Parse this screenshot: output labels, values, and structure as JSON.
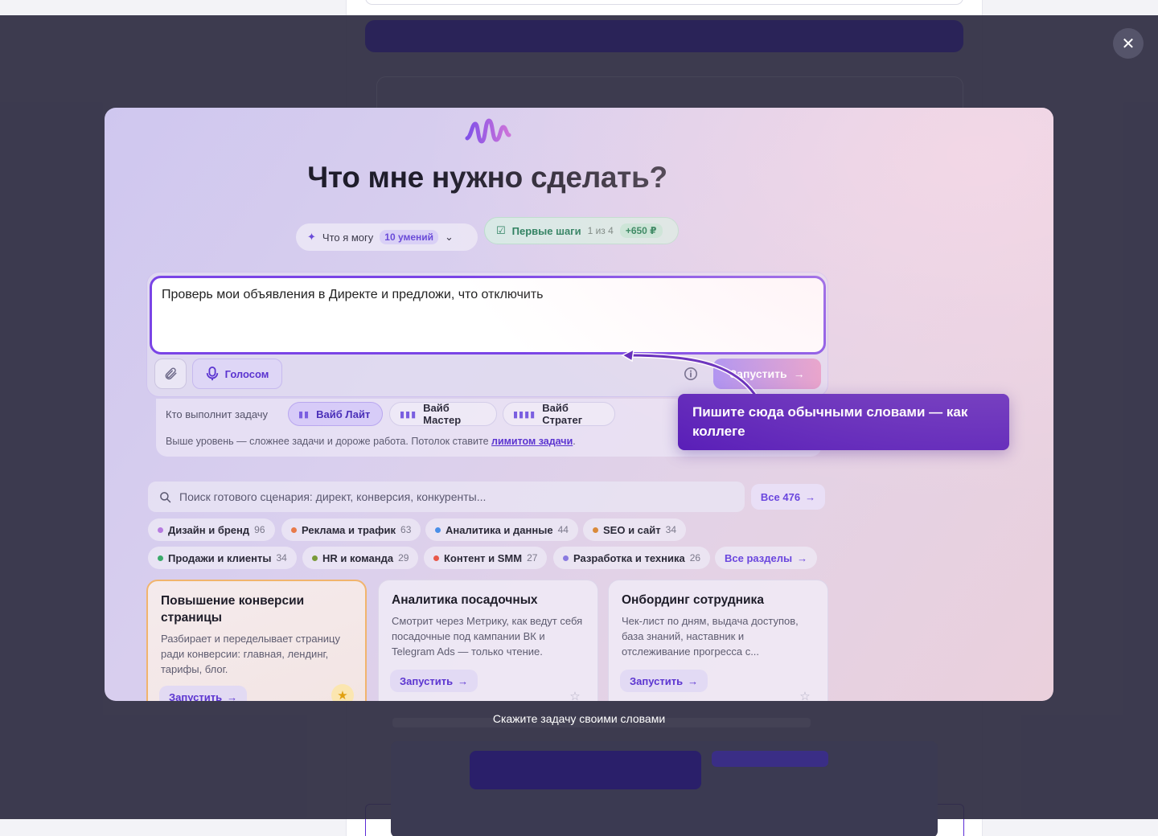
{
  "close_label": "✕",
  "shot": {
    "title": "Что мне нужно сделать?",
    "skills": {
      "label": "Что я могу",
      "badge": "10 умений"
    },
    "steps": {
      "label": "Первые шаги",
      "progress": "1 из 4",
      "reward": "+650 ₽"
    },
    "prompt": "Проверь мои объявления в Директе и предложи, что отключить",
    "voice_label": "Голосом",
    "run_label": "Запустить",
    "exec_label": "Кто выполнит задачу",
    "tiers": [
      "Вайб Лайт",
      "Вайб Мастер",
      "Вайб Стратег"
    ],
    "exec_note": "Выше уровень — сложнее задачи и дороже работа. Потолок ставите",
    "exec_link": "лимитом задачи",
    "exec_end": ".",
    "callout": "Пишите сюда обычными словами — как коллеге",
    "search_placeholder": "Поиск готового сценария: директ, конверсия, конкуренты...",
    "all_label": "Все 476",
    "categories": [
      {
        "label": "Дизайн и бренд",
        "count": "96",
        "color": "#b77be0"
      },
      {
        "label": "Реклама и трафик",
        "count": "63",
        "color": "#e87a4a"
      },
      {
        "label": "Аналитика и данные",
        "count": "44",
        "color": "#4a8fe8"
      },
      {
        "label": "SEO и сайт",
        "count": "34",
        "color": "#d98a3a"
      },
      {
        "label": "Продажи и клиенты",
        "count": "34",
        "color": "#3aaa6a"
      },
      {
        "label": "HR и команда",
        "count": "29",
        "color": "#7a9a3a"
      },
      {
        "label": "Контент и SMM",
        "count": "27",
        "color": "#e8584a"
      },
      {
        "label": "Разработка и техника",
        "count": "26",
        "color": "#8a7ae0"
      }
    ],
    "all_sections": "Все разделы",
    "cards": [
      {
        "title": "Повышение конверсии страницы",
        "desc": "Разбирает и переделывает страницу ради конверсии: главная, лендинг, тарифы, блог.",
        "run": "Запустить"
      },
      {
        "title": "Аналитика посадочных",
        "desc": "Смотрит через Метрику, как ведут себя посадочные под кампании ВК и Telegram Ads — только чтение.",
        "run": "Запустить"
      },
      {
        "title": "Онбординг сотрудника",
        "desc": "Чек-лист по дням, выдача доступов, база знаний, наставник и отслеживание прогресса с...",
        "run": "Запустить"
      }
    ]
  },
  "caption": "Скажите задачу своими словами"
}
